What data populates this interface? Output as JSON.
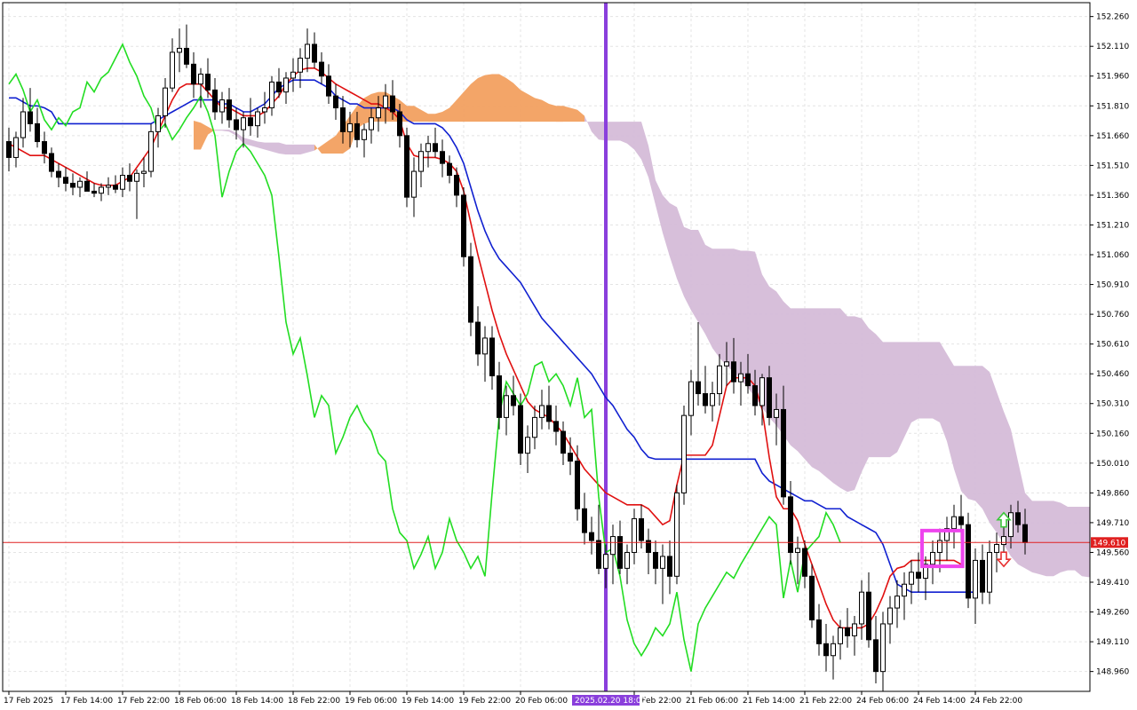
{
  "window": {
    "title": ""
  },
  "chart_data": {
    "type": "candlestick",
    "symbol": "",
    "timeframe": "",
    "ylim": [
      148.86,
      152.33
    ],
    "y_ticks": [
      152.26,
      152.11,
      151.96,
      151.81,
      151.66,
      151.51,
      151.36,
      151.21,
      151.06,
      150.91,
      150.76,
      150.61,
      150.46,
      150.31,
      150.16,
      150.01,
      149.86,
      149.71,
      149.56,
      149.41,
      149.26,
      149.11,
      148.96
    ],
    "y_tick_labels": [
      "152.260",
      "152.110",
      "151.960",
      "151.810",
      "151.660",
      "151.510",
      "151.360",
      "151.210",
      "151.060",
      "150.910",
      "150.760",
      "150.610",
      "150.460",
      "150.310",
      "150.160",
      "150.010",
      "149.860",
      "149.710",
      "149.560",
      "149.410",
      "149.260",
      "149.110",
      "148.960"
    ],
    "x_ticks": [
      {
        "i": 0,
        "label": "17 Feb 2025"
      },
      {
        "i": 8,
        "label": "17 Feb 14:00"
      },
      {
        "i": 16,
        "label": "17 Feb 22:00"
      },
      {
        "i": 24,
        "label": "18 Feb 06:00"
      },
      {
        "i": 32,
        "label": "18 Feb 14:00"
      },
      {
        "i": 40,
        "label": "18 Feb 22:00"
      },
      {
        "i": 48,
        "label": "19 Feb 06:00"
      },
      {
        "i": 56,
        "label": "19 Feb 14:00"
      },
      {
        "i": 64,
        "label": "19 Feb 22:00"
      },
      {
        "i": 72,
        "label": "20 Feb 06:00"
      },
      {
        "i": 88,
        "label": "20 Feb 22:00"
      },
      {
        "i": 96,
        "label": "21 Feb 06:00"
      },
      {
        "i": 104,
        "label": "21 Feb 14:00"
      },
      {
        "i": 112,
        "label": "21 Feb 22:00"
      },
      {
        "i": 120,
        "label": "24 Feb 06:00"
      },
      {
        "i": 128,
        "label": "24 Feb 14:00"
      },
      {
        "i": 136,
        "label": "24 Feb 22:00"
      }
    ],
    "grid": true,
    "current_price": {
      "value": 149.61,
      "label": "149.610",
      "color": "#e02020"
    },
    "vertical_marker": {
      "i": 84,
      "label": "2025.02.20 18:00",
      "color": "#8a3fdc"
    },
    "highlight_box": {
      "i_from": 128.5,
      "i_to": 134.2,
      "high": 149.67,
      "low": 149.49,
      "color": "#ee44ee"
    },
    "signal_arrows": [
      {
        "type": "up",
        "i": 140,
        "price": 149.72,
        "color": "#3cc83c"
      },
      {
        "type": "down",
        "i": 140,
        "price": 149.53,
        "color": "#e83030"
      }
    ],
    "candles": [
      [
        151.63,
        151.7,
        151.48,
        151.55
      ],
      [
        151.55,
        151.68,
        151.5,
        151.65
      ],
      [
        151.65,
        151.85,
        151.6,
        151.78
      ],
      [
        151.78,
        151.9,
        151.68,
        151.72
      ],
      [
        151.72,
        151.8,
        151.6,
        151.63
      ],
      [
        151.63,
        151.68,
        151.52,
        151.57
      ],
      [
        151.57,
        151.6,
        151.45,
        151.48
      ],
      [
        151.48,
        151.52,
        151.4,
        151.45
      ],
      [
        151.45,
        151.5,
        151.38,
        151.42
      ],
      [
        151.42,
        151.47,
        151.36,
        151.4
      ],
      [
        151.4,
        151.45,
        151.35,
        151.43
      ],
      [
        151.43,
        151.48,
        151.38,
        151.38
      ],
      [
        151.38,
        151.42,
        151.35,
        151.37
      ],
      [
        151.37,
        151.42,
        151.33,
        151.4
      ],
      [
        151.4,
        151.45,
        151.36,
        151.41
      ],
      [
        151.41,
        151.46,
        151.37,
        151.39
      ],
      [
        151.39,
        151.5,
        151.35,
        151.46
      ],
      [
        151.46,
        151.52,
        151.38,
        151.43
      ],
      [
        151.43,
        151.49,
        151.24,
        151.47
      ],
      [
        151.47,
        151.55,
        151.4,
        151.48
      ],
      [
        151.48,
        151.72,
        151.45,
        151.68
      ],
      [
        151.68,
        151.8,
        151.6,
        151.76
      ],
      [
        151.76,
        151.95,
        151.7,
        151.9
      ],
      [
        151.9,
        152.15,
        151.88,
        152.08
      ],
      [
        152.08,
        152.2,
        151.98,
        152.1
      ],
      [
        152.1,
        152.22,
        152.0,
        152.02
      ],
      [
        152.02,
        152.08,
        151.85,
        151.92
      ],
      [
        151.92,
        152.0,
        151.8,
        151.97
      ],
      [
        151.97,
        152.05,
        151.85,
        151.89
      ],
      [
        151.89,
        151.95,
        151.74,
        151.78
      ],
      [
        151.78,
        151.88,
        151.72,
        151.84
      ],
      [
        151.84,
        151.9,
        151.7,
        151.74
      ],
      [
        151.74,
        151.8,
        151.64,
        151.69
      ],
      [
        151.69,
        151.78,
        151.6,
        151.75
      ],
      [
        151.75,
        151.85,
        151.66,
        151.71
      ],
      [
        151.71,
        151.8,
        151.65,
        151.78
      ],
      [
        151.78,
        151.88,
        151.72,
        151.8
      ],
      [
        151.8,
        151.96,
        151.76,
        151.93
      ],
      [
        151.93,
        152.0,
        151.85,
        151.88
      ],
      [
        151.88,
        151.98,
        151.82,
        151.95
      ],
      [
        151.95,
        152.05,
        151.88,
        151.98
      ],
      [
        151.98,
        152.1,
        151.9,
        152.05
      ],
      [
        152.05,
        152.2,
        151.98,
        152.12
      ],
      [
        152.12,
        152.18,
        152.0,
        152.03
      ],
      [
        152.03,
        152.08,
        151.92,
        151.96
      ],
      [
        151.96,
        152.02,
        151.82,
        151.86
      ],
      [
        151.86,
        151.92,
        151.74,
        151.8
      ],
      [
        151.8,
        151.86,
        151.62,
        151.68
      ],
      [
        151.68,
        151.78,
        151.6,
        151.72
      ],
      [
        151.72,
        151.78,
        151.6,
        151.64
      ],
      [
        151.64,
        151.72,
        151.55,
        151.69
      ],
      [
        151.69,
        151.8,
        151.62,
        151.75
      ],
      [
        151.75,
        151.86,
        151.68,
        151.8
      ],
      [
        151.8,
        151.92,
        151.72,
        151.86
      ],
      [
        151.86,
        151.94,
        151.74,
        151.78
      ],
      [
        151.78,
        151.82,
        151.6,
        151.66
      ],
      [
        151.66,
        151.7,
        151.3,
        151.35
      ],
      [
        151.35,
        151.55,
        151.25,
        151.48
      ],
      [
        151.48,
        151.62,
        151.4,
        151.58
      ],
      [
        151.58,
        151.66,
        151.5,
        151.62
      ],
      [
        151.62,
        151.7,
        151.55,
        151.58
      ],
      [
        151.58,
        151.64,
        151.45,
        151.52
      ],
      [
        151.52,
        151.56,
        151.42,
        151.46
      ],
      [
        151.46,
        151.5,
        151.3,
        151.36
      ],
      [
        151.36,
        151.4,
        151.0,
        151.05
      ],
      [
        151.05,
        151.12,
        150.65,
        150.72
      ],
      [
        150.72,
        150.8,
        150.5,
        150.56
      ],
      [
        150.56,
        150.7,
        150.42,
        150.64
      ],
      [
        150.64,
        150.7,
        150.38,
        150.45
      ],
      [
        150.45,
        150.52,
        150.18,
        150.24
      ],
      [
        150.24,
        150.4,
        150.15,
        150.35
      ],
      [
        150.35,
        150.45,
        150.25,
        150.3
      ],
      [
        150.3,
        150.36,
        150.0,
        150.06
      ],
      [
        150.06,
        150.2,
        149.96,
        150.14
      ],
      [
        150.14,
        150.3,
        150.08,
        150.24
      ],
      [
        150.24,
        150.38,
        150.18,
        150.3
      ],
      [
        150.3,
        150.4,
        150.18,
        150.22
      ],
      [
        150.22,
        150.3,
        150.1,
        150.17
      ],
      [
        150.17,
        150.22,
        150.0,
        150.06
      ],
      [
        150.06,
        150.14,
        149.95,
        150.02
      ],
      [
        150.02,
        150.1,
        149.72,
        149.78
      ],
      [
        149.78,
        149.86,
        149.6,
        149.66
      ],
      [
        149.66,
        149.74,
        149.55,
        149.62
      ],
      [
        149.62,
        149.8,
        149.45,
        149.48
      ],
      [
        149.48,
        149.6,
        149.38,
        149.55
      ],
      [
        149.55,
        149.7,
        149.4,
        149.64
      ],
      [
        149.64,
        149.72,
        149.45,
        149.48
      ],
      [
        149.48,
        149.6,
        149.4,
        149.56
      ],
      [
        149.56,
        149.78,
        149.5,
        149.73
      ],
      [
        149.73,
        149.8,
        149.58,
        149.62
      ],
      [
        149.62,
        149.68,
        149.45,
        149.56
      ],
      [
        149.56,
        149.62,
        149.4,
        149.48
      ],
      [
        149.48,
        149.6,
        149.3,
        149.54
      ],
      [
        149.54,
        149.62,
        149.35,
        149.44
      ],
      [
        149.44,
        149.9,
        149.4,
        149.86
      ],
      [
        149.86,
        150.3,
        149.8,
        150.25
      ],
      [
        150.25,
        150.48,
        150.15,
        150.42
      ],
      [
        150.42,
        150.72,
        150.3,
        150.36
      ],
      [
        150.36,
        150.5,
        150.26,
        150.3
      ],
      [
        150.3,
        150.42,
        150.22,
        150.36
      ],
      [
        150.36,
        150.56,
        150.3,
        150.5
      ],
      [
        150.5,
        150.62,
        150.4,
        150.52
      ],
      [
        150.52,
        150.64,
        150.36,
        150.42
      ],
      [
        150.42,
        150.52,
        150.3,
        150.46
      ],
      [
        150.46,
        150.56,
        150.36,
        150.4
      ],
      [
        150.4,
        150.48,
        150.25,
        150.3
      ],
      [
        150.3,
        150.46,
        150.2,
        150.44
      ],
      [
        150.44,
        150.5,
        150.2,
        150.24
      ],
      [
        150.24,
        150.36,
        150.1,
        150.28
      ],
      [
        150.28,
        150.4,
        149.8,
        149.84
      ],
      [
        149.84,
        149.92,
        149.5,
        149.56
      ],
      [
        149.56,
        149.64,
        149.4,
        149.58
      ],
      [
        149.58,
        149.62,
        149.38,
        149.44
      ],
      [
        149.44,
        149.5,
        149.18,
        149.22
      ],
      [
        149.22,
        149.3,
        149.04,
        149.1
      ],
      [
        149.1,
        149.2,
        148.96,
        149.04
      ],
      [
        149.04,
        149.14,
        148.92,
        149.1
      ],
      [
        149.1,
        149.22,
        149.02,
        149.18
      ],
      [
        149.18,
        149.28,
        149.08,
        149.14
      ],
      [
        149.14,
        149.24,
        149.04,
        149.2
      ],
      [
        149.2,
        149.42,
        149.12,
        149.36
      ],
      [
        149.36,
        149.46,
        149.08,
        149.12
      ],
      [
        149.12,
        149.24,
        148.9,
        148.96
      ],
      [
        148.96,
        149.26,
        148.86,
        149.2
      ],
      [
        149.2,
        149.34,
        149.1,
        149.28
      ],
      [
        149.28,
        149.42,
        149.18,
        149.34
      ],
      [
        149.34,
        149.46,
        149.22,
        149.4
      ],
      [
        149.4,
        149.52,
        149.3,
        149.46
      ],
      [
        149.46,
        149.56,
        149.36,
        149.43
      ],
      [
        149.43,
        149.54,
        149.32,
        149.5
      ],
      [
        149.5,
        149.62,
        149.4,
        149.56
      ],
      [
        149.56,
        149.68,
        149.46,
        149.62
      ],
      [
        149.62,
        149.74,
        149.52,
        149.68
      ],
      [
        149.68,
        149.8,
        149.58,
        149.74
      ],
      [
        149.74,
        149.85,
        149.62,
        149.7
      ],
      [
        149.7,
        149.76,
        149.28,
        149.33
      ],
      [
        149.33,
        149.58,
        149.2,
        149.52
      ],
      [
        149.52,
        149.6,
        149.3,
        149.36
      ],
      [
        149.36,
        149.62,
        149.3,
        149.56
      ],
      [
        149.56,
        149.66,
        149.46,
        149.6
      ],
      [
        149.6,
        149.72,
        149.5,
        149.64
      ],
      [
        149.64,
        149.8,
        149.58,
        149.76
      ],
      [
        149.76,
        149.82,
        149.66,
        149.7
      ],
      [
        149.7,
        149.78,
        149.55,
        149.61
      ]
    ],
    "tenkan": [
      151.62,
      151.6,
      151.58,
      151.56,
      151.56,
      151.56,
      151.54,
      151.52,
      151.5,
      151.48,
      151.46,
      151.44,
      151.42,
      151.41,
      151.41,
      151.41,
      151.43,
      151.45,
      151.5,
      151.55,
      151.6,
      151.68,
      151.76,
      151.84,
      151.9,
      151.92,
      151.92,
      151.92,
      151.88,
      151.84,
      151.8,
      151.8,
      151.78,
      151.76,
      151.76,
      151.76,
      151.78,
      151.82,
      151.86,
      151.92,
      151.96,
      151.99,
      152.0,
      152.0,
      151.98,
      151.95,
      151.92,
      151.9,
      151.88,
      151.86,
      151.84,
      151.82,
      151.82,
      151.8,
      151.78,
      151.74,
      151.62,
      151.56,
      151.55,
      151.55,
      151.55,
      151.54,
      151.52,
      151.48,
      151.38,
      151.22,
      151.06,
      150.92,
      150.78,
      150.66,
      150.56,
      150.48,
      150.4,
      150.32,
      150.28,
      150.26,
      150.24,
      150.2,
      150.16,
      150.1,
      150.04,
      149.98,
      149.94,
      149.9,
      149.86,
      149.84,
      149.82,
      149.8,
      149.8,
      149.8,
      149.78,
      149.74,
      149.7,
      149.72,
      149.9,
      150.05,
      150.05,
      150.05,
      150.05,
      150.1,
      150.25,
      150.4,
      150.44,
      150.44,
      150.44,
      150.4,
      150.28,
      150.04,
      149.84,
      149.78,
      149.78,
      149.72,
      149.6,
      149.5,
      149.4,
      149.3,
      149.22,
      149.18,
      149.18,
      149.18,
      149.18,
      149.2,
      149.26,
      149.34,
      149.44,
      149.48,
      149.49,
      149.52,
      149.52,
      149.52,
      149.52,
      149.52,
      149.52,
      149.52,
      149.5
    ],
    "kijun": [
      151.85,
      151.85,
      151.83,
      151.81,
      151.81,
      151.8,
      151.78,
      151.72,
      151.72,
      151.72,
      151.72,
      151.72,
      151.72,
      151.72,
      151.72,
      151.72,
      151.72,
      151.72,
      151.72,
      151.72,
      151.72,
      151.74,
      151.76,
      151.78,
      151.8,
      151.82,
      151.84,
      151.84,
      151.84,
      151.84,
      151.82,
      151.82,
      151.8,
      151.78,
      151.78,
      151.8,
      151.82,
      151.86,
      151.9,
      151.92,
      151.94,
      151.94,
      151.94,
      151.94,
      151.92,
      151.9,
      151.86,
      151.84,
      151.82,
      151.82,
      151.8,
      151.8,
      151.8,
      151.8,
      151.8,
      151.78,
      151.74,
      151.72,
      151.72,
      151.72,
      151.72,
      151.7,
      151.66,
      151.6,
      151.52,
      151.4,
      151.28,
      151.18,
      151.1,
      151.04,
      151.0,
      150.96,
      150.92,
      150.86,
      150.8,
      150.74,
      150.7,
      150.66,
      150.62,
      150.58,
      150.54,
      150.5,
      150.46,
      150.4,
      150.34,
      150.3,
      150.24,
      150.18,
      150.14,
      150.08,
      150.04,
      150.03,
      150.03,
      150.03,
      150.03,
      150.03,
      150.03,
      150.03,
      150.03,
      150.03,
      150.03,
      150.03,
      150.03,
      150.03,
      150.03,
      150.03,
      149.96,
      149.92,
      149.9,
      149.88,
      149.86,
      149.84,
      149.82,
      149.82,
      149.8,
      149.78,
      149.78,
      149.78,
      149.74,
      149.72,
      149.7,
      149.68,
      149.66,
      149.6,
      149.5,
      149.4,
      149.38,
      149.36,
      149.36,
      149.36,
      149.36,
      149.36,
      149.36,
      149.36,
      149.36,
      149.36,
      149.36
    ]
  },
  "colors": {
    "tenkan": "#e01010",
    "kijun": "#1020d0",
    "chikou": "#22dd22",
    "kumo_bear": "#d5bcd8",
    "kumo_bull": "#f2a060",
    "candle_bull": "#ffffff",
    "candle_bear": "#000000"
  }
}
